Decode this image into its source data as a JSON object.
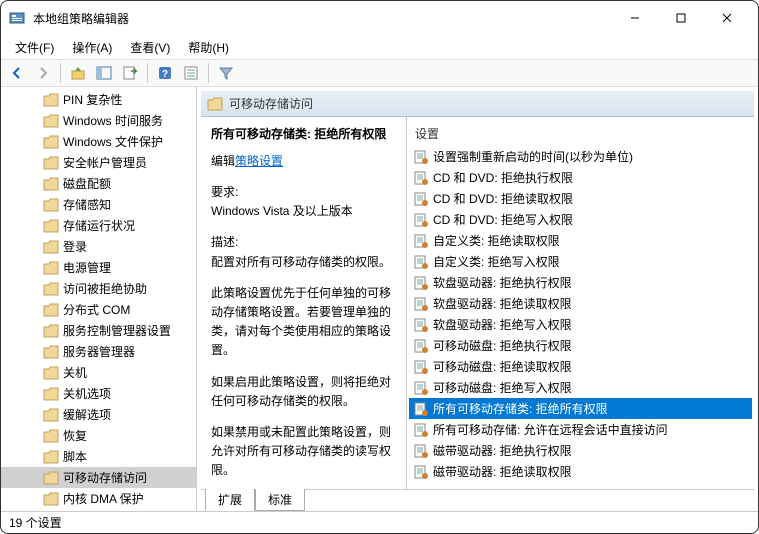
{
  "window": {
    "title": "本地组策略编辑器"
  },
  "menubar": {
    "file": "文件(F)",
    "action": "操作(A)",
    "view": "查看(V)",
    "help": "帮助(H)"
  },
  "header": {
    "title": "可移动存储访问"
  },
  "tree": {
    "items": [
      "PIN 复杂性",
      "Windows 时间服务",
      "Windows 文件保护",
      "安全帐户管理员",
      "磁盘配额",
      "存储感知",
      "存储运行状况",
      "登录",
      "电源管理",
      "访问被拒绝协助",
      "分布式 COM",
      "服务控制管理器设置",
      "服务器管理器",
      "关机",
      "关机选项",
      "缓解选项",
      "恢复",
      "脚本",
      "可移动存储访问",
      "内核 DMA 保护"
    ],
    "selectedIndex": 18
  },
  "desc": {
    "name": "所有可移动存储类: 拒绝所有权限",
    "editPrefix": "编辑",
    "editLink": "策略设置",
    "reqLabel": "要求:",
    "reqText": "Windows Vista 及以上版本",
    "descLabel": "描述:",
    "descText": "配置对所有可移动存储类的权限。",
    "para1": "此策略设置优先于任何单独的可移动存储策略设置。若要管理单独的类，请对每个类使用相应的策略设置。",
    "para2": "如果启用此策略设置，则将拒绝对任何可移动存储类的权限。",
    "para3": "如果禁用或未配置此策略设置，则允许对所有可移动存储类的读写权限。"
  },
  "list": {
    "header": "设置",
    "items": [
      "设置强制重新启动的时间(以秒为单位)",
      "CD 和 DVD: 拒绝执行权限",
      "CD 和 DVD: 拒绝读取权限",
      "CD 和 DVD: 拒绝写入权限",
      "自定义类: 拒绝读取权限",
      "自定义类: 拒绝写入权限",
      "软盘驱动器: 拒绝执行权限",
      "软盘驱动器: 拒绝读取权限",
      "软盘驱动器: 拒绝写入权限",
      "可移动磁盘: 拒绝执行权限",
      "可移动磁盘: 拒绝读取权限",
      "可移动磁盘: 拒绝写入权限",
      "所有可移动存储类: 拒绝所有权限",
      "所有可移动存储: 允许在远程会话中直接访问",
      "磁带驱动器: 拒绝执行权限",
      "磁带驱动器: 拒绝读取权限"
    ],
    "selectedIndex": 12
  },
  "tabs": {
    "extended": "扩展",
    "standard": "标准"
  },
  "statusbar": {
    "text": "19 个设置"
  }
}
